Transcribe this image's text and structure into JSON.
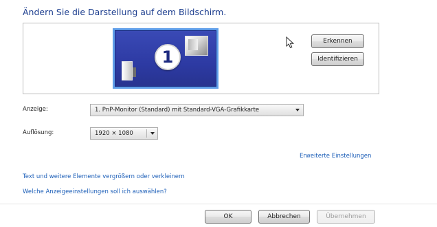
{
  "heading": "Ändern Sie die Darstellung auf dem Bildschirm.",
  "preview": {
    "monitor_number": "1",
    "detect_button": "Erkennen",
    "identify_button": "Identifizieren"
  },
  "display": {
    "label": "Anzeige:",
    "value": "1. PnP-Monitor (Standard) mit Standard-VGA-Grafikkarte"
  },
  "resolution": {
    "label": "Auflösung:",
    "value": "1920 × 1080"
  },
  "links": {
    "advanced_settings": "Erweiterte Einstellungen",
    "text_size": "Text und weitere Elemente vergrößern oder verkleinern",
    "which_settings": "Welche Anzeigeeinstellungen soll ich auswählen?"
  },
  "footer": {
    "ok": "OK",
    "cancel": "Abbrechen",
    "apply": "Übernehmen"
  },
  "icons": {
    "cursor": "mouse-pointer-icon",
    "monitor_preview": "monitor-icon",
    "small_monitor": "computer-monitor-icon",
    "tower": "computer-tower-icon",
    "dropdown": "chevron-down-icon"
  },
  "colors": {
    "heading": "#1e3f8f",
    "link": "#1d5fb8",
    "monitor_fill": "#2d3aa3",
    "monitor_border": "#5f9ee9"
  }
}
